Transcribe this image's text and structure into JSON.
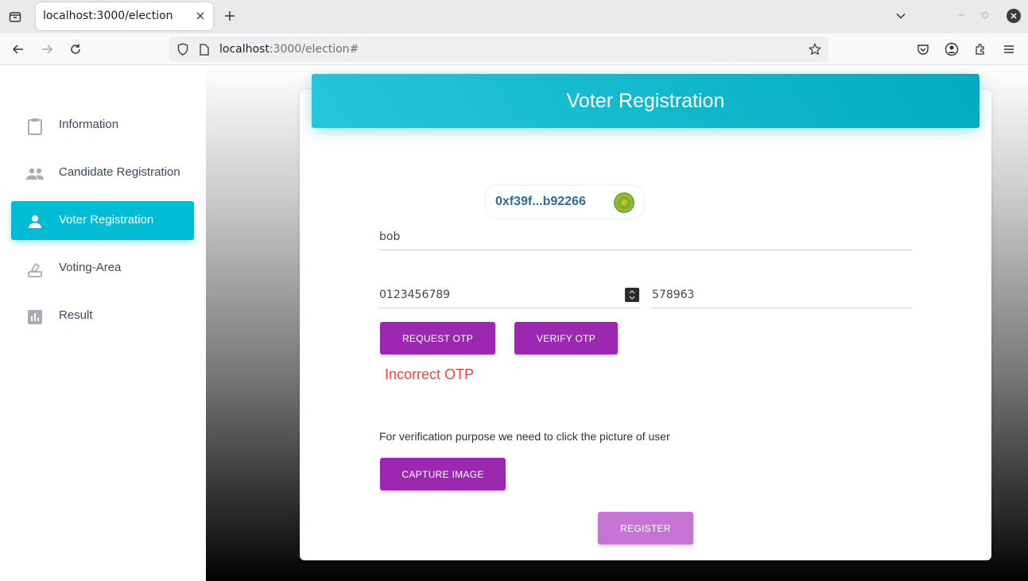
{
  "browser": {
    "tab_title": "localhost:3000/election",
    "url_host": "localhost",
    "url_rest": ":3000/election#"
  },
  "sidebar": {
    "items": [
      {
        "label": "Information",
        "icon": "clipboard-icon"
      },
      {
        "label": "Candidate Registration",
        "icon": "people-icon"
      },
      {
        "label": "Voter Registration",
        "icon": "person-icon",
        "active": true
      },
      {
        "label": "Voting-Area",
        "icon": "ballot-icon"
      },
      {
        "label": "Result",
        "icon": "bar-chart-icon"
      }
    ]
  },
  "card": {
    "title": "Voter Registration",
    "account": "0xf39f...b92266",
    "name_value": "bob",
    "phone_value": "0123456789",
    "otp_value": "578963",
    "request_otp_label": "REQUEST OTP",
    "verify_otp_label": "VERIFY OTP",
    "error_text": "Incorrect OTP",
    "hint_text": "For verification purpose we need to click the picture of user",
    "capture_label": "CAPTURE IMAGE",
    "register_label": "REGISTER"
  },
  "colors": {
    "accent": "#00bcd4",
    "button": "#9c27b0",
    "error": "#f44336"
  }
}
